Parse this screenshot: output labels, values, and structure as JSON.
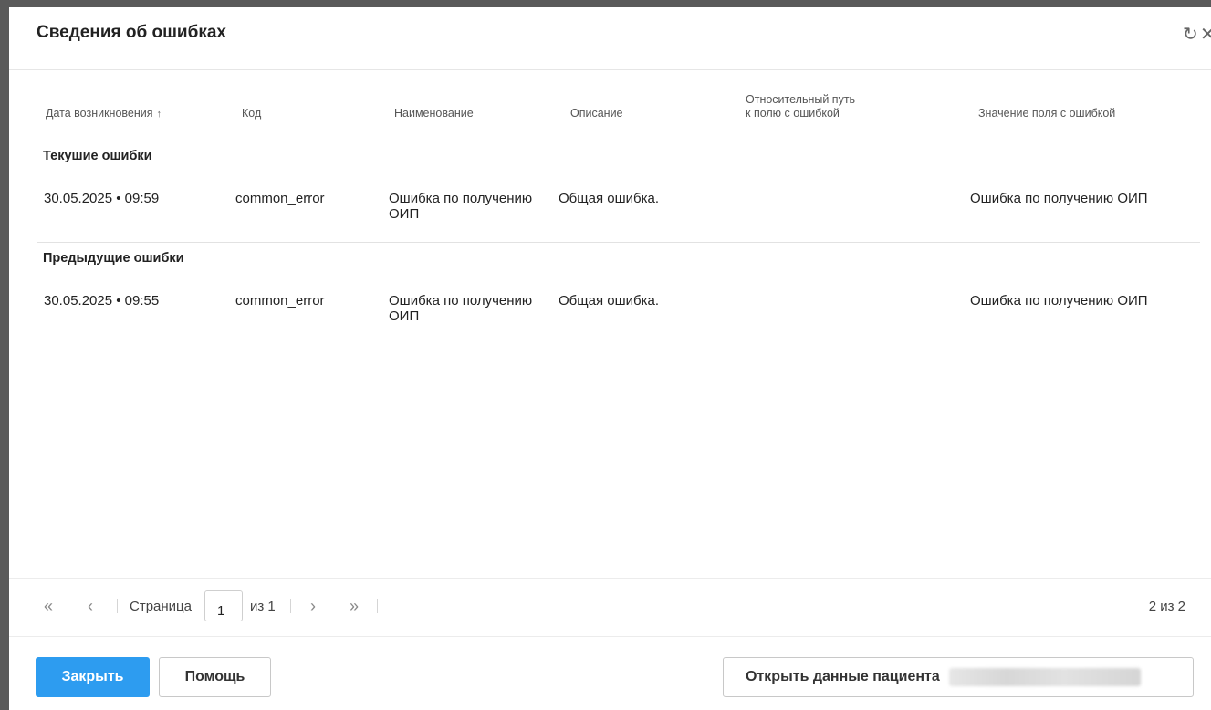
{
  "dialog": {
    "title": "Сведения об ошибках",
    "refresh_icon": "↻",
    "close_icon": "✕"
  },
  "table": {
    "columns": [
      {
        "label": "Дата возникновения",
        "sort": "↑"
      },
      {
        "label": "Код"
      },
      {
        "label": "Наименование"
      },
      {
        "label": "Описание"
      },
      {
        "label_line1": "Относительный путь",
        "label_line2": "к полю с ошибкой"
      },
      {
        "label": "Значение поля с ошибкой"
      }
    ],
    "groups": [
      {
        "label": "Текушие ошибки",
        "rows": [
          {
            "date": "30.05.2025 • 09:59",
            "code": "common_error",
            "name_line1": "Ошибка по получению",
            "name_line2": "ОИП",
            "description": "Общая ошибка.",
            "path": "",
            "value": "Ошибка по получению ОИП"
          }
        ]
      },
      {
        "label": "Предыдущие ошибки",
        "rows": [
          {
            "date": "30.05.2025 • 09:55",
            "code": "common_error",
            "name_line1": "Ошибка по получению",
            "name_line2": "ОИП",
            "description": "Общая ошибка.",
            "path": "",
            "value": "Ошибка по получению ОИП"
          }
        ]
      }
    ]
  },
  "pager": {
    "first_icon": "«",
    "prev_icon": "‹",
    "page_label": "Страница",
    "page_value": "1",
    "of_label": "из 1",
    "next_icon": "›",
    "last_icon": "»",
    "count": "2 из 2"
  },
  "footer": {
    "close_label": "Закрыть",
    "help_label": "Помощь",
    "open_patient_label": "Открыть данные пациента"
  },
  "colors": {
    "primary": "#2d9cf0",
    "overlay": "#5a5a5a"
  }
}
